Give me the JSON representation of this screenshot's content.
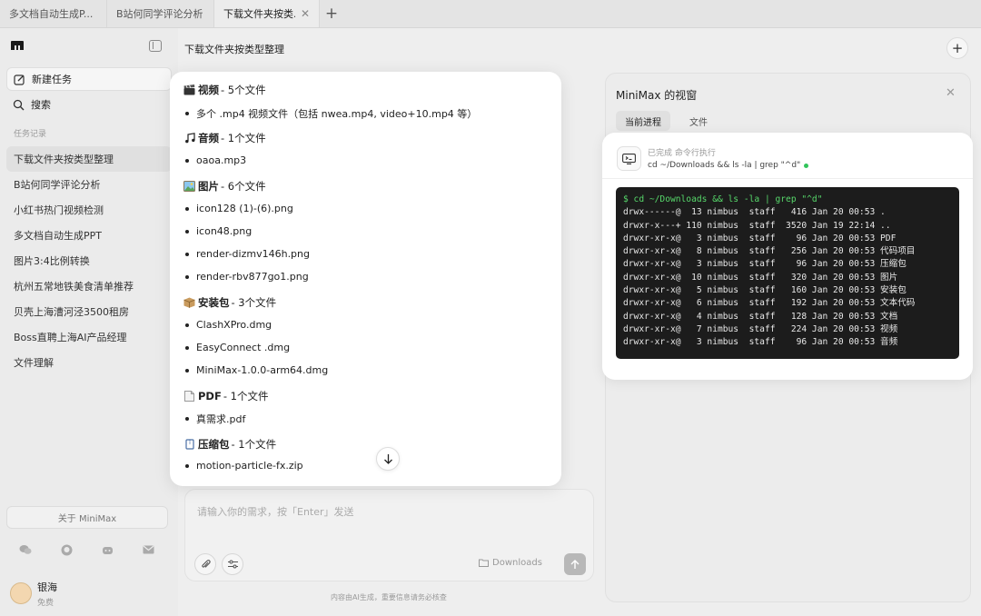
{
  "tabs": [
    {
      "label": "多文档自动生成P..."
    },
    {
      "label": "B站何同学评论分析"
    },
    {
      "label": "下载文件夹按类..."
    }
  ],
  "sidebar": {
    "new_task": "新建任务",
    "search": "搜索",
    "history_label": "任务记录",
    "history": [
      "下载文件夹按类型整理",
      "B站何同学评论分析",
      "小红书热门视频检测",
      "多文档自动生成PPT",
      "图片3:4比例转换",
      "杭州五常地铁美食清单推荐",
      "贝壳上海漕河泾3500租房",
      "Boss直聘上海AI产品经理",
      "文件理解"
    ],
    "about": "关于 MiniMax",
    "user": {
      "name": "银海",
      "plan": "免费"
    }
  },
  "main": {
    "title": "下载文件夹按类型整理",
    "input_placeholder": "请输入你的需求，按「Enter」发送",
    "folder": "Downloads",
    "disclaimer": "内容由AI生成，重要信息请务必核查"
  },
  "file_list": {
    "categories": [
      {
        "icon": "clapper-icon",
        "name": "视频",
        "count": " - 5个文件",
        "files": [
          "多个 .mp4 视频文件（包括 nwea.mp4, video+10.mp4 等）"
        ]
      },
      {
        "icon": "music-note-icon",
        "name": "音频",
        "count": " - 1个文件",
        "files": [
          "oaoa.mp3"
        ]
      },
      {
        "icon": "picture-icon",
        "name": "图片",
        "count": " - 6个文件",
        "files": [
          "icon128 (1)-(6).png",
          "icon48.png",
          "render-dizmv146h.png",
          "render-rbv877go1.png"
        ]
      },
      {
        "icon": "package-icon",
        "name": "安装包",
        "count": " - 3个文件",
        "files": [
          "ClashXPro.dmg",
          "EasyConnect .dmg",
          "MiniMax-1.0.0-arm64.dmg"
        ]
      },
      {
        "icon": "document-icon",
        "name": "PDF",
        "count": " - 1个文件",
        "files": [
          "真需求.pdf"
        ]
      },
      {
        "icon": "archive-icon",
        "name": "压缩包",
        "count": " - 1个文件",
        "files": [
          "motion-particle-fx.zip"
        ]
      }
    ]
  },
  "right_panel": {
    "title": "MiniMax 的视窗",
    "tabs": [
      "当前进程",
      "文件"
    ],
    "status": "已完成 命令行执行",
    "command_preview": "cd ~/Downloads && ls -la | grep \"^d\"",
    "terminal_prompt": "$ cd ~/Downloads && ls -la | grep \"^d\"",
    "terminal_lines": [
      "drwx------@  13 nimbus  staff   416 Jan 20 00:53 .",
      "drwxr-x---+ 110 nimbus  staff  3520 Jan 19 22:14 ..",
      "drwxr-xr-x@   3 nimbus  staff    96 Jan 20 00:53 PDF",
      "drwxr-xr-x@   8 nimbus  staff   256 Jan 20 00:53 代码项目",
      "drwxr-xr-x@   3 nimbus  staff    96 Jan 20 00:53 压缩包",
      "drwxr-xr-x@  10 nimbus  staff   320 Jan 20 00:53 图片",
      "drwxr-xr-x@   5 nimbus  staff   160 Jan 20 00:53 安装包",
      "drwxr-xr-x@   6 nimbus  staff   192 Jan 20 00:53 文本代码",
      "drwxr-xr-x@   4 nimbus  staff   128 Jan 20 00:53 文档",
      "drwxr-xr-x@   7 nimbus  staff   224 Jan 20 00:53 视频",
      "drwxr-xr-x@   3 nimbus  staff    96 Jan 20 00:53 音频"
    ]
  },
  "colors": {
    "accent_green": "#31c45a",
    "terminal_bg": "#1c1c1c",
    "prompt_green": "#57d96b"
  }
}
